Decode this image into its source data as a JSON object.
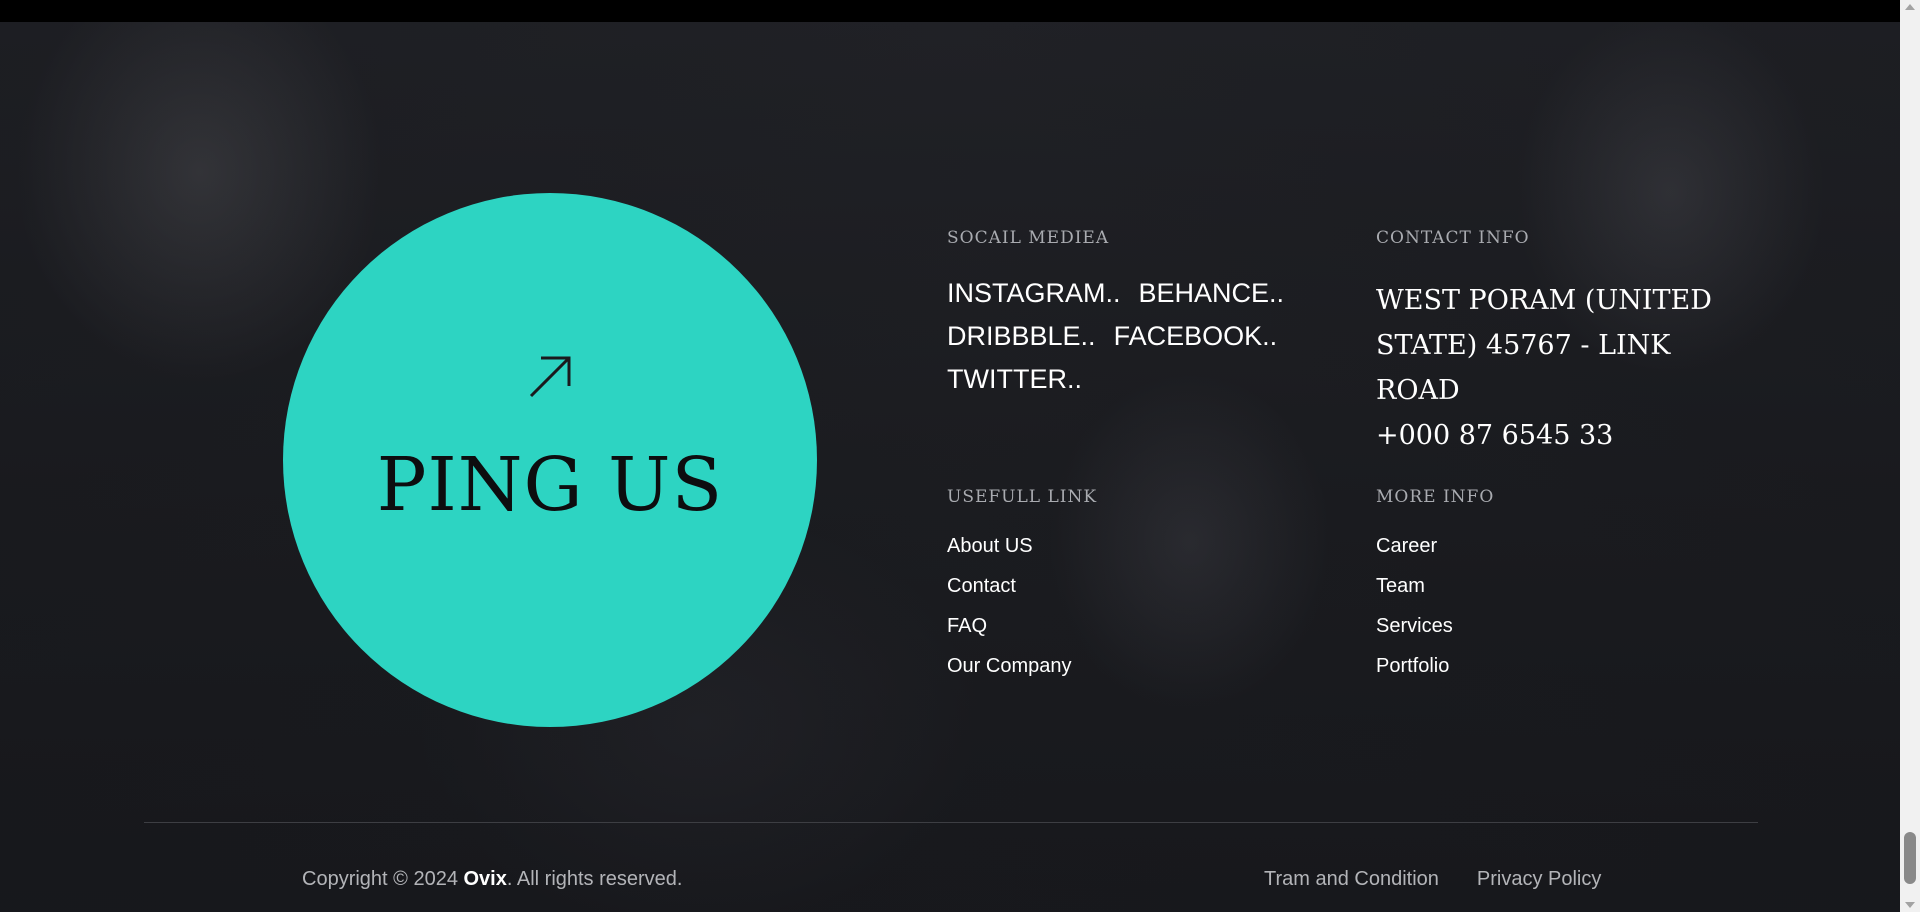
{
  "ping": {
    "label": "PING US",
    "icon": "arrow-up-right-icon",
    "color": "#2dd4c2"
  },
  "social": {
    "heading": "SOCAIL MEDIEA",
    "links": [
      "INSTAGRAM..",
      "BEHANCE..",
      "DRIBBBLE..",
      "FACEBOOK..",
      "TWITTER.."
    ]
  },
  "contact": {
    "heading": "CONTACT INFO",
    "address": "WEST PORAM (UNITED STATE) 45767 - LINK ROAD",
    "phone": "+000 87 6545 33"
  },
  "useful": {
    "heading": "USEFULL LINK",
    "links": [
      "About US",
      "Contact",
      "FAQ",
      "Our Company"
    ]
  },
  "more": {
    "heading": "MORE INFO",
    "links": [
      "Career",
      "Team",
      "Services",
      "Portfolio"
    ]
  },
  "bottom": {
    "copyright_prefix": "Copyright © 2024 ",
    "brand": "Ovix",
    "copyright_suffix": ". All rights reserved.",
    "terms": "Tram and Condition",
    "privacy": "Privacy Policy"
  }
}
